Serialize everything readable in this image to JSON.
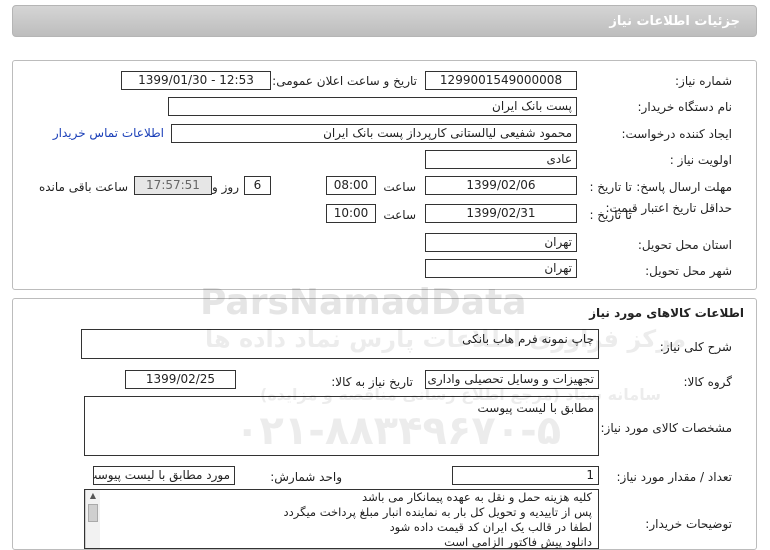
{
  "header": {
    "title": "جزئیات اطلاعات نیاز"
  },
  "need": {
    "number_label": "شماره نیاز:",
    "number": "1299001549000008",
    "announce_label": "تاریخ و ساعت اعلان عمومی:",
    "announce": "1399/01/30 - 12:53",
    "buyer_label": "نام دستگاه خریدار:",
    "buyer": "پست بانک ایران",
    "creator_label": "ایجاد کننده درخواست:",
    "creator": "محمود شفیعی لیالستانی کارپرداز پست بانک ایران",
    "contact_link": "اطلاعات تماس خریدار",
    "priority_label": "اولویت نیاز :",
    "priority": "عادی",
    "reply_label": "مهلت ارسال پاسخ:",
    "reply_to": "تا تاریخ :",
    "reply_date": "1399/02/06",
    "time_label": "ساعت",
    "reply_time": "08:00",
    "days": "6",
    "days_label": "روز و",
    "remaining": "17:57:51",
    "remaining_label": "ساعت باقی مانده",
    "validity_label": "حداقل تاریخ اعتبار قیمت:",
    "validity_to": "تا تاریخ :",
    "validity_date": "1399/02/31",
    "validity_time_label": "ساعت",
    "validity_time": "10:00",
    "province_label": "استان محل تحویل:",
    "province": "تهران",
    "city_label": "شهر محل تحویل:",
    "city": "تهران"
  },
  "goods": {
    "section_title": "اطلاعات کالاهای مورد نیاز",
    "desc_label": "شرح کلی نیاز:",
    "desc": "چاپ نمونه فرم هاب بانکی",
    "group_label": "گروه کالا:",
    "group": "تجهیزات و وسایل تحصیلی واداری",
    "need_date_label": "تاریخ نیاز به کالا:",
    "need_date": "1399/02/25",
    "spec_label": "مشخصات کالای مورد نیاز:",
    "spec": "مطابق با لیست پیوست",
    "qty_label": "تعداد / مقدار مورد نیاز:",
    "qty": "1",
    "unit_label": "واحد شمارش:",
    "unit": "مورد مطابق با لیست پیوست",
    "notes_label": "توضیحات خریدار:",
    "notes": [
      "کلیه هزینه حمل و نقل به عهده پیمانکار می باشد",
      "پس از تاییدیه و تحویل کل بار به نماینده انبار مبلغ پرداخت میگردد",
      "لطفا در قالب یک ایران کد قیمت داده شود",
      "دانلود پیش فاکتور الزامی است"
    ]
  },
  "watermark": {
    "brand": "ParsNamadData",
    "tagline": "مرکز فراوری اطلاعات پارس نماد داده ها",
    "subtitle": "سامانه ستاد (مرجع اطلاع رسانی مناقصه و مزایده)",
    "phone": "۰۲۱-۸۸۳۴۹۶۷۰-۵"
  }
}
